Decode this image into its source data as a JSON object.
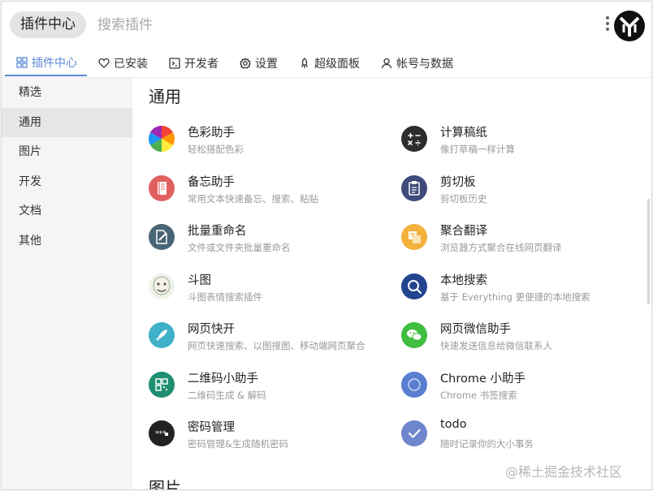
{
  "header": {
    "title": "插件中心",
    "search_placeholder": "搜索插件"
  },
  "tabs": [
    {
      "label": "插件中心",
      "icon": "grid-icon",
      "active": true
    },
    {
      "label": "已安装",
      "icon": "heart-icon"
    },
    {
      "label": "开发者",
      "icon": "terminal-icon"
    },
    {
      "label": "设置",
      "icon": "gear-icon"
    },
    {
      "label": "超级面板",
      "icon": "rocket-icon"
    },
    {
      "label": "帐号与数据",
      "icon": "user-icon"
    }
  ],
  "sidebar": {
    "items": [
      {
        "label": "精选"
      },
      {
        "label": "通用",
        "active": true
      },
      {
        "label": "图片"
      },
      {
        "label": "开发"
      },
      {
        "label": "文档"
      },
      {
        "label": "其他"
      }
    ]
  },
  "main": {
    "section_title": "通用",
    "next_section_title": "图片",
    "plugins": [
      {
        "name": "色彩助手",
        "desc": "轻松搭配色彩",
        "icon": "color-wheel-icon"
      },
      {
        "name": "计算稿纸",
        "desc": "像打草稿一样计算",
        "icon": "calculator-icon",
        "color": "#2d2d2d"
      },
      {
        "name": "备忘助手",
        "desc": "常用文本快速备忘、搜索、粘贴",
        "icon": "notebook-icon",
        "color": "#e06060"
      },
      {
        "name": "剪切板",
        "desc": "剪切板历史",
        "icon": "clipboard-icon",
        "color": "#3d4a7a"
      },
      {
        "name": "批量重命名",
        "desc": "文件或文件夹批量重命名",
        "icon": "rename-icon",
        "color": "#4a6575"
      },
      {
        "name": "聚合翻译",
        "desc": "浏览器方式聚合在线网页翻译",
        "icon": "translate-icon",
        "color": "#f2b23c"
      },
      {
        "name": "斗图",
        "desc": "斗图表情搜索插件",
        "icon": "meme-face-icon"
      },
      {
        "name": "本地搜索",
        "desc": "基于 Everything 更便捷的本地搜索",
        "icon": "magnifier-icon",
        "color": "#23448f"
      },
      {
        "name": "网页快开",
        "desc": "网页快速搜索、以图搜图、移动端网页聚合",
        "icon": "rocket-icon",
        "color": "#3fb0c8"
      },
      {
        "name": "网页微信助手",
        "desc": "快速发送信息给微信联系人",
        "icon": "wechat-icon",
        "color": "#3fbe3f"
      },
      {
        "name": "二维码小助手",
        "desc": "二维码生成 & 解码",
        "icon": "qrcode-icon",
        "color": "#1f8f72"
      },
      {
        "name": "Chrome 小助手",
        "desc": "Chrome 书签搜索",
        "icon": "chrome-icon",
        "color": "#5a7fd0"
      },
      {
        "name": "密码管理",
        "desc": "密码管理&生成随机密码",
        "icon": "password-icon",
        "color": "#222222"
      },
      {
        "name": "todo",
        "desc": "随时记录你的大小事务",
        "icon": "checkmark-icon",
        "color": "#6f86cf"
      }
    ]
  },
  "watermark": "@稀土掘金技术社区",
  "colors": {
    "accent": "#5b8ad6",
    "sidebar_bg": "#f5f5f5",
    "sidebar_active": "#e6e6e6"
  }
}
